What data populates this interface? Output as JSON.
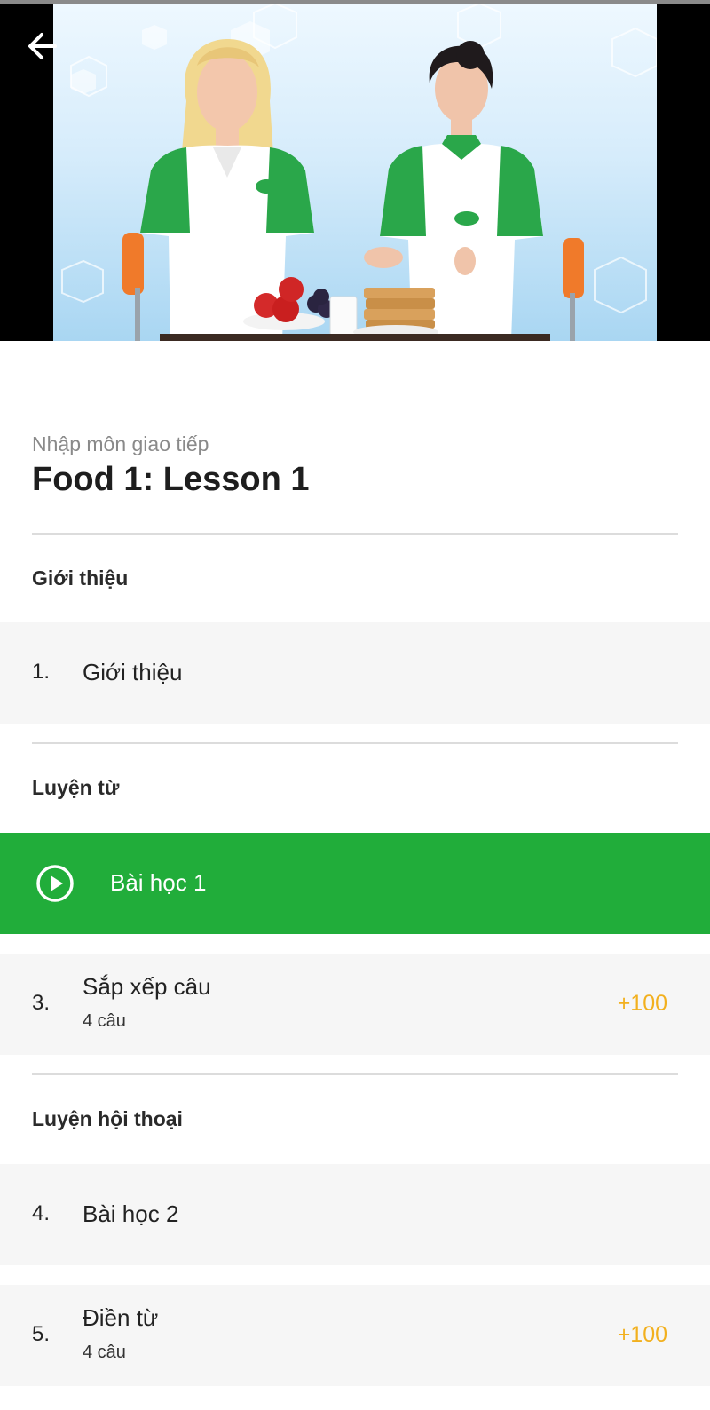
{
  "lesson": {
    "subtitle": "Nhập môn giao tiếp",
    "title": "Food 1: Lesson 1"
  },
  "sections": [
    {
      "heading": "Giới thiệu",
      "items": [
        {
          "number": "1.",
          "label": "Giới thiệu"
        }
      ]
    },
    {
      "heading": "Luyện từ",
      "items": [
        {
          "label": "Bài học 1",
          "active": true,
          "icon": "play-circle-icon"
        },
        {
          "number": "3.",
          "label": "Sắp xếp câu",
          "detail": "4 câu",
          "points": "+100"
        }
      ]
    },
    {
      "heading": "Luyện hội thoại",
      "items": [
        {
          "number": "4.",
          "label": "Bài học 2"
        },
        {
          "number": "5.",
          "label": "Điền từ",
          "detail": "4 câu",
          "points": "+100"
        }
      ]
    }
  ],
  "colors": {
    "active_row": "#21ad3a",
    "points": "#f2b01e",
    "row_bg": "#f6f6f6",
    "subtitle": "#8a8a8a"
  },
  "icons": {
    "back": "arrow-left-icon",
    "play": "play-circle-icon"
  }
}
